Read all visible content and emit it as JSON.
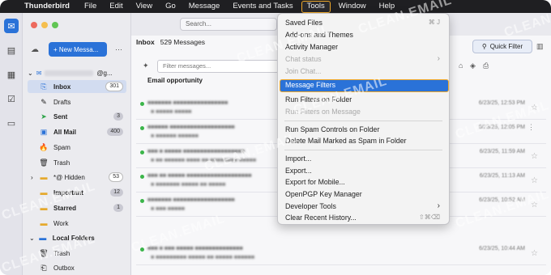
{
  "menubar": {
    "app": "Thunderbird",
    "items": [
      "File",
      "Edit",
      "View",
      "Go",
      "Message",
      "Events and Tasks",
      "Tools",
      "Window",
      "Help"
    ]
  },
  "toolbar": {
    "search_placeholder": "Search...",
    "new_message": "+ New Messa...",
    "quick_filter": "Quick Filter"
  },
  "folders": {
    "account": "@g...",
    "items": [
      {
        "label": "Inbox",
        "count": "301"
      },
      {
        "label": "Drafts",
        "count": ""
      },
      {
        "label": "Sent",
        "count": "3"
      },
      {
        "label": "All Mail",
        "count": "400"
      },
      {
        "label": "Spam",
        "count": ""
      },
      {
        "label": "Trash",
        "count": ""
      },
      {
        "label": "*@ Hidden",
        "count": "53"
      },
      {
        "label": "Important",
        "count": "12"
      },
      {
        "label": "Starred",
        "count": "1"
      },
      {
        "label": "Work",
        "count": ""
      }
    ],
    "local_header": "Local Folders",
    "local_items": [
      "Trash",
      "Outbox"
    ]
  },
  "inbox": {
    "title": "Inbox",
    "count": "529 Messages",
    "filter_placeholder": "Filter messages...",
    "first_subject": "Email opportunity",
    "dates": [
      "6/23/25, 12:53 PM",
      "6/23/25, 12:05 PM",
      "6/23/25, 11:59 AM",
      "6/23/25, 11:13 AM",
      "6/23/25, 10:52 AM",
      "6/23/25, 10:44 AM"
    ]
  },
  "tools_menu": {
    "items": [
      {
        "label": "Saved Files",
        "shortcut": "⌘ J",
        "disabled": false
      },
      {
        "label": "Add-ons and Themes",
        "shortcut": "",
        "disabled": false
      },
      {
        "label": "Activity Manager",
        "shortcut": "",
        "disabled": false
      },
      {
        "label": "Chat status",
        "shortcut": "›",
        "disabled": true
      },
      {
        "label": "Join Chat...",
        "shortcut": "",
        "disabled": true
      },
      {
        "label": "Message Filters",
        "shortcut": "",
        "disabled": false
      },
      {
        "label": "Run Filters on Folder",
        "shortcut": "",
        "disabled": false
      },
      {
        "label": "Run Filters on Message",
        "shortcut": "",
        "disabled": true
      },
      {
        "label": "Run Spam Controls on Folder",
        "shortcut": "",
        "disabled": false
      },
      {
        "label": "Delete Mail Marked as Spam in Folder",
        "shortcut": "",
        "disabled": false
      },
      {
        "label": "Import...",
        "shortcut": "",
        "disabled": false
      },
      {
        "label": "Export...",
        "shortcut": "",
        "disabled": false
      },
      {
        "label": "Export for Mobile...",
        "shortcut": "",
        "disabled": false
      },
      {
        "label": "OpenPGP Key Manager",
        "shortcut": "",
        "disabled": false
      },
      {
        "label": "Developer Tools",
        "shortcut": "›",
        "disabled": false
      },
      {
        "label": "Clear Recent History...",
        "shortcut": "⇧⌘⌫",
        "disabled": false
      }
    ]
  },
  "watermark": "CLEAN.EMAIL",
  "colors": {
    "accent": "#2a72d8",
    "highlight_border": "#f0a92a",
    "menubar": "#1f1f22"
  }
}
